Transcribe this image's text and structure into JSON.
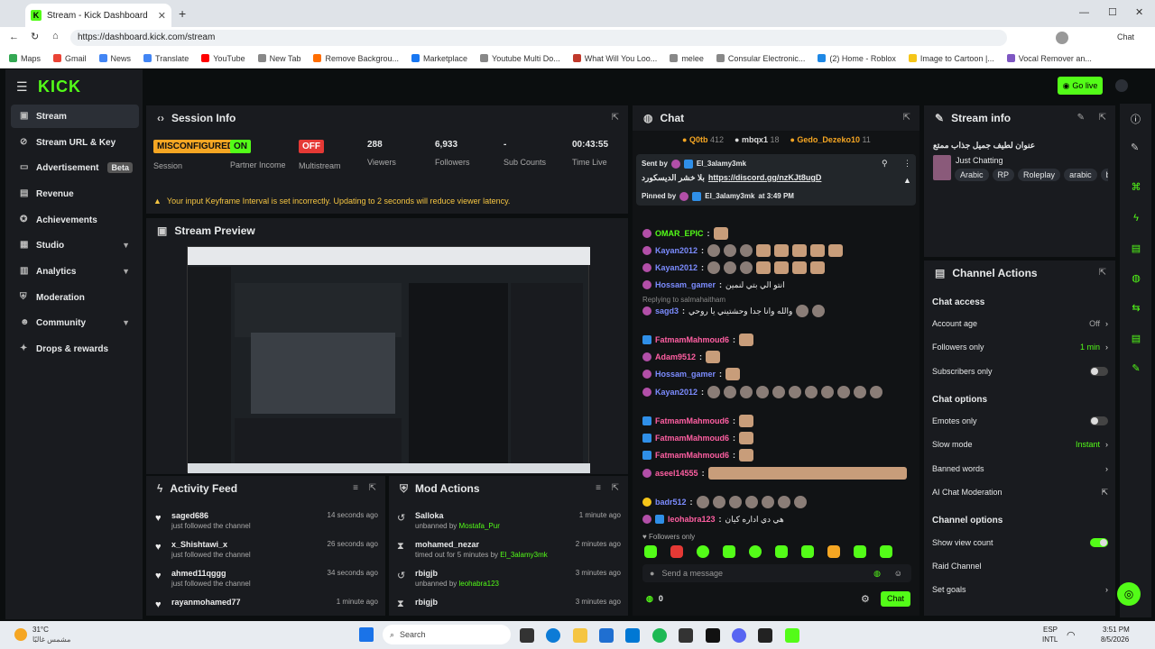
{
  "browser": {
    "tab_title": "Stream - Kick Dashboard",
    "url": "https://dashboard.kick.com/stream",
    "profile_label": "Chat",
    "bookmarks": [
      "Maps",
      "Gmail",
      "News",
      "Translate",
      "YouTube",
      "New Tab",
      "Remove Backgrou...",
      "Marketplace",
      "Youtube Multi Do...",
      "What Will You Loo...",
      "melee",
      "Consular Electronic...",
      "(2) Home - Roblox",
      "Image to Cartoon |...",
      "Vocal Remover an..."
    ]
  },
  "sidebar": {
    "logo": "KICK",
    "items": [
      {
        "label": "Stream"
      },
      {
        "label": "Stream URL & Key"
      },
      {
        "label": "Advertisement",
        "badge": "Beta"
      },
      {
        "label": "Revenue"
      },
      {
        "label": "Achievements"
      },
      {
        "label": "Studio"
      },
      {
        "label": "Analytics"
      },
      {
        "label": "Moderation"
      },
      {
        "label": "Community"
      },
      {
        "label": "Drops & rewards"
      }
    ]
  },
  "session": {
    "title": "Session Info",
    "stats": [
      {
        "value": "MISCONFIGURED",
        "label": "Session"
      },
      {
        "value": "ON",
        "label": "Partner Income"
      },
      {
        "value": "OFF",
        "label": "Multistream"
      },
      {
        "value": "288",
        "label": "Viewers"
      },
      {
        "value": "6,933",
        "label": "Followers"
      },
      {
        "value": "-",
        "label": "Sub Counts"
      },
      {
        "value": "00:43:55",
        "label": "Time Live"
      }
    ],
    "warning": "Your input Keyframe Interval is set incorrectly. Updating to 2 seconds will reduce viewer latency."
  },
  "preview": {
    "title": "Stream Preview"
  },
  "activity": {
    "title": "Activity Feed",
    "items": [
      {
        "name": "saged686",
        "sub": "just followed the channel",
        "time": "14 seconds ago"
      },
      {
        "name": "x_Shishtawi_x",
        "sub": "just followed the channel",
        "time": "26 seconds ago"
      },
      {
        "name": "ahmed11qggg",
        "sub": "just followed the channel",
        "time": "34 seconds ago"
      },
      {
        "name": "rayanmohamed77",
        "sub": "",
        "time": "1 minute ago"
      }
    ]
  },
  "mod": {
    "title": "Mod Actions",
    "items": [
      {
        "name": "Salloka",
        "sub": "unbanned by",
        "by": "Mostafa_Pur",
        "time": "1 minute ago"
      },
      {
        "name": "mohamed_nezar",
        "sub": "timed out for 5 minutes by",
        "by": "El_3alamy3mk",
        "time": "2 minutes ago"
      },
      {
        "name": "rbigjb",
        "sub": "unbanned by",
        "by": "leohabra123",
        "time": "3 minutes ago"
      },
      {
        "name": "rbigjb",
        "sub": "",
        "by": "",
        "time": "3 minutes ago"
      }
    ]
  },
  "chat": {
    "title": "Chat",
    "top": [
      {
        "name": "Q0tb",
        "n": "412"
      },
      {
        "name": "mbqx1",
        "n": "18"
      },
      {
        "name": "Gedo_Dezeko10",
        "n": "11"
      }
    ],
    "pinned": {
      "sent_by_label": "Sent by",
      "sent_by": "El_3alamy3mk",
      "link": "https://discord.gg/nzKJt8ugD",
      "link_prefix": "بلا خشر الديسكورد",
      "pinned_by_label": "Pinned by",
      "pinned_by": "El_3alamy3mk",
      "pinned_at": "at 3:49 PM"
    },
    "messages": [
      {
        "user": "OMAR_EPIC",
        "color": "#53fc18",
        "text": ""
      },
      {
        "user": "Kayan2012",
        "color": "#7c8cff",
        "text": ""
      },
      {
        "user": "Kayan2012",
        "color": "#7c8cff",
        "text": ""
      },
      {
        "user": "Hossam_gamer",
        "color": "#7c8cff",
        "text": "انتو الي بتي لنمين"
      },
      {
        "user": "sagd3",
        "color": "#7c8cff",
        "text": "والله وانا جدا وحشتيني يا روحي",
        "reply": "Replying to salmahaitham"
      },
      {
        "user": "FatmamMahmoud6",
        "color": "#ff5fa2",
        "text": ""
      },
      {
        "user": "Adam9512",
        "color": "#ff5fa2",
        "text": ""
      },
      {
        "user": "Hossam_gamer",
        "color": "#7c8cff",
        "text": ""
      },
      {
        "user": "Kayan2012",
        "color": "#7c8cff",
        "text": ""
      },
      {
        "user": "FatmamMahmoud6",
        "color": "#ff5fa2",
        "text": ""
      },
      {
        "user": "FatmamMahmoud6",
        "color": "#ff5fa2",
        "text": ""
      },
      {
        "user": "FatmamMahmoud6",
        "color": "#ff5fa2",
        "text": ""
      },
      {
        "user": "aseel14555",
        "color": "#ff5fa2",
        "text": ""
      },
      {
        "user": "badr512",
        "color": "#7c8cff",
        "text": ""
      },
      {
        "user": "leohabra123",
        "color": "#ff5fa2",
        "text": "هي دي اداره كيان"
      }
    ],
    "followers_only": "Followers only",
    "placeholder": "Send a message",
    "count": "0",
    "send": "Chat"
  },
  "stream_info": {
    "title": "Stream info",
    "stream_title": "عنوان لطيف جميل جذاب ممتع",
    "category": "Just Chatting",
    "tags": [
      "Arabic",
      "RP",
      "Roleplay",
      "arabic",
      "bor"
    ]
  },
  "channel_actions": {
    "title": "Channel Actions",
    "chat_access": "Chat access",
    "account_age": "Account age",
    "account_age_val": "Off",
    "followers_only": "Followers only",
    "followers_only_val": "1 min",
    "subs_only": "Subscribers only",
    "chat_options": "Chat options",
    "emotes_only": "Emotes only",
    "slow_mode": "Slow mode",
    "slow_mode_val": "Instant",
    "banned_words": "Banned words",
    "ai_mod": "AI Chat Moderation",
    "channel_options": "Channel options",
    "show_view_count": "Show view count",
    "raid_channel": "Raid Channel",
    "set_goals": "Set goals"
  },
  "header": {
    "go_live": "Go live"
  },
  "taskbar": {
    "weather_temp": "31°C",
    "weather_desc": "مشمس غالبًا",
    "search": "Search",
    "lang": "ESP",
    "kbd": "INTL",
    "time": "3:51 PM",
    "date": "8/5/2026"
  },
  "colors": {
    "accent": "#53fc18",
    "panel": "#191b1f",
    "bg": "#0b0e0f"
  }
}
